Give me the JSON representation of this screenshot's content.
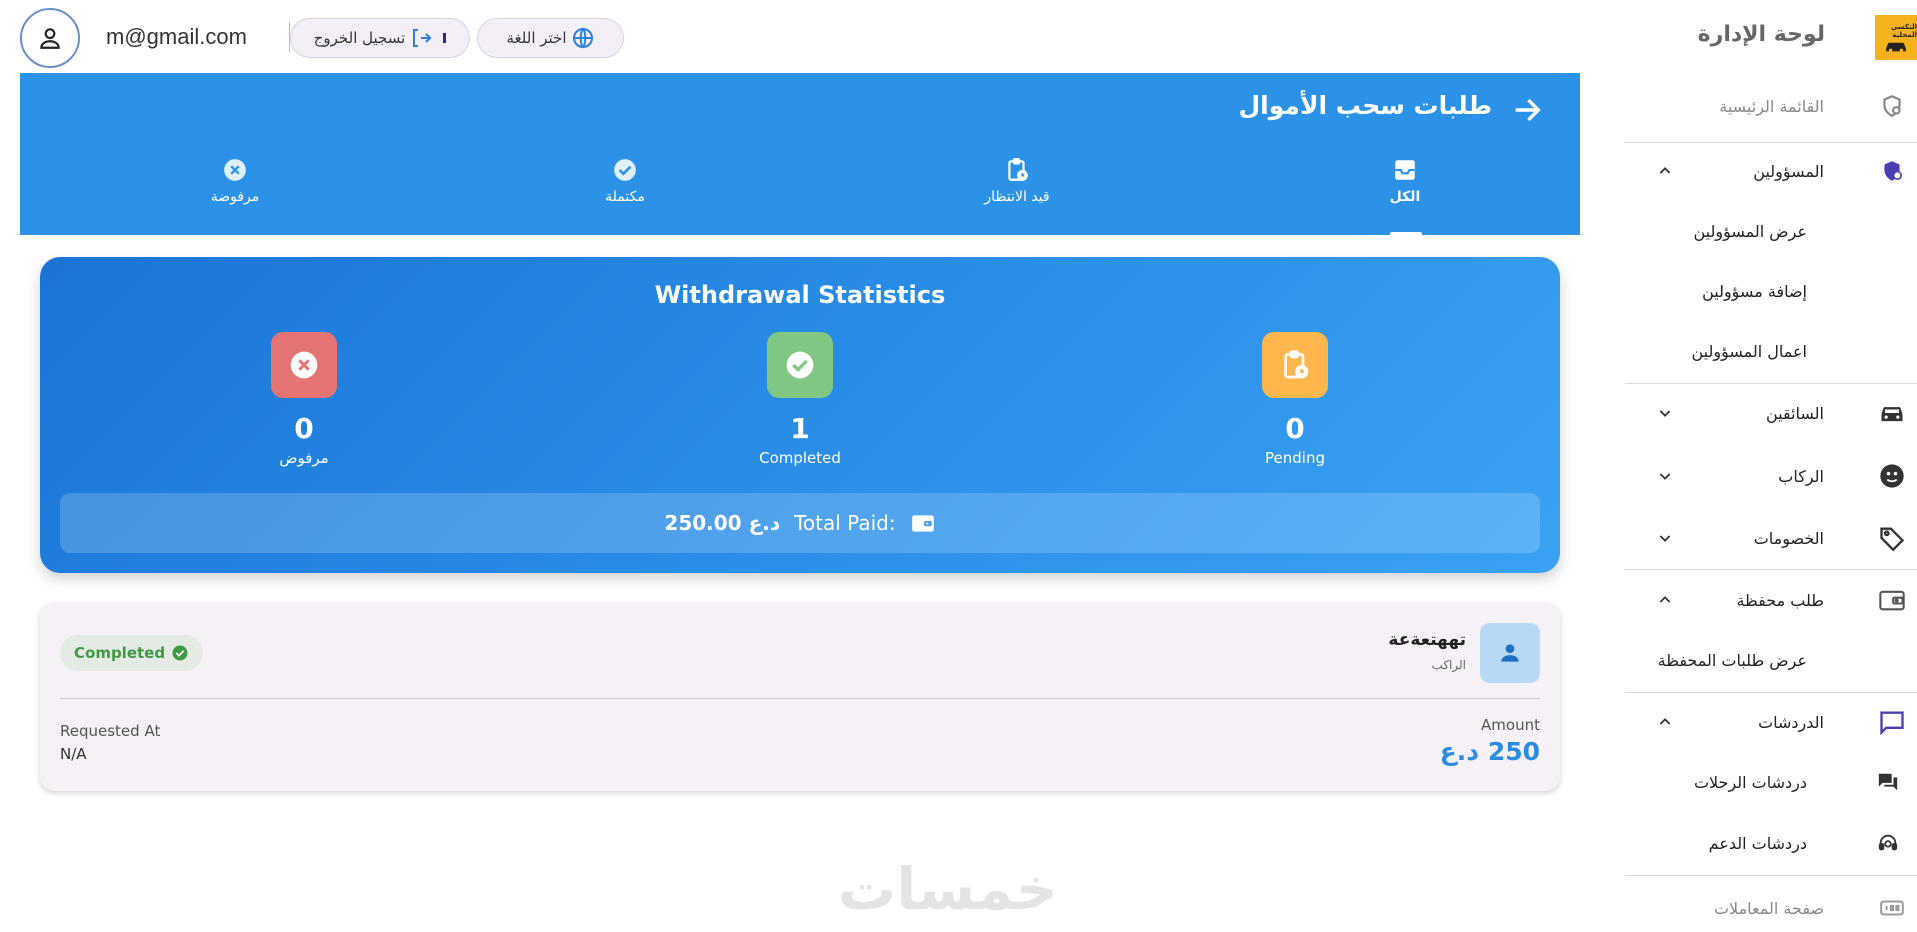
{
  "topbar": {
    "email": "m@gmail.com",
    "logout_label": "تسجيل الخروج",
    "language_label": "اختر اللغة"
  },
  "header": {
    "title": "طلبات سحب الأموال",
    "tabs": [
      {
        "label": "الكل",
        "icon": "inbox-icon",
        "active": true
      },
      {
        "label": "قيد الانتظار",
        "icon": "clipboard-clock-icon",
        "active": false
      },
      {
        "label": "مكتملة",
        "icon": "check-circle-icon",
        "active": false
      },
      {
        "label": "مرفوضة",
        "icon": "x-circle-icon",
        "active": false
      }
    ]
  },
  "stats": {
    "title": "Withdrawal Statistics",
    "rejected": {
      "value": "0",
      "label": "مرفوض",
      "color": "#e57373"
    },
    "completed": {
      "value": "1",
      "label": "Completed",
      "color": "#81c784"
    },
    "pending": {
      "value": "0",
      "label": "Pending",
      "color": "#ffb74d"
    },
    "total_label": "Total Paid:",
    "total_value": "250.00 د.ع"
  },
  "request": {
    "name": "تههتعةعة",
    "role": "الراكب",
    "status": "Completed",
    "requested_at_label": "Requested At",
    "requested_at_value": "N/A",
    "amount_label": "Amount",
    "amount_value": "250 د.ع"
  },
  "watermark": "خمسات",
  "sidebar": {
    "brand_title": "لوحة الإدارة",
    "brand_logo_text": "التكسي المحلية",
    "items": [
      {
        "label": "القائمة الرئيسية",
        "icon": "shield-home-icon"
      },
      {
        "label": "المسؤولين",
        "icon": "admin-shield-icon",
        "expanded": true
      },
      {
        "label": "عرض المسؤولين"
      },
      {
        "label": "إضافة مسؤولين"
      },
      {
        "label": "اعمال المسؤولين"
      },
      {
        "label": "السائقين",
        "icon": "car-icon",
        "expanded": false
      },
      {
        "label": "الركاب",
        "icon": "smile-icon",
        "expanded": false
      },
      {
        "label": "الخصومات",
        "icon": "tag-icon",
        "expanded": false
      },
      {
        "label": "طلب محفظة",
        "icon": "wallet-icon",
        "expanded": true
      },
      {
        "label": "عرض طلبات المحفظة"
      },
      {
        "label": "الدردشات",
        "icon": "chat-icon",
        "expanded": true
      },
      {
        "label": "دردشات الرحلات",
        "icon": "forum-icon"
      },
      {
        "label": "دردشات الدعم",
        "icon": "support-agent-icon"
      },
      {
        "label": "صفحة المعاملات",
        "icon": "counter-icon"
      }
    ]
  },
  "colors": {
    "primary": "#2b92e8",
    "success": "#3f9a44",
    "amount": "#2b8be0"
  }
}
